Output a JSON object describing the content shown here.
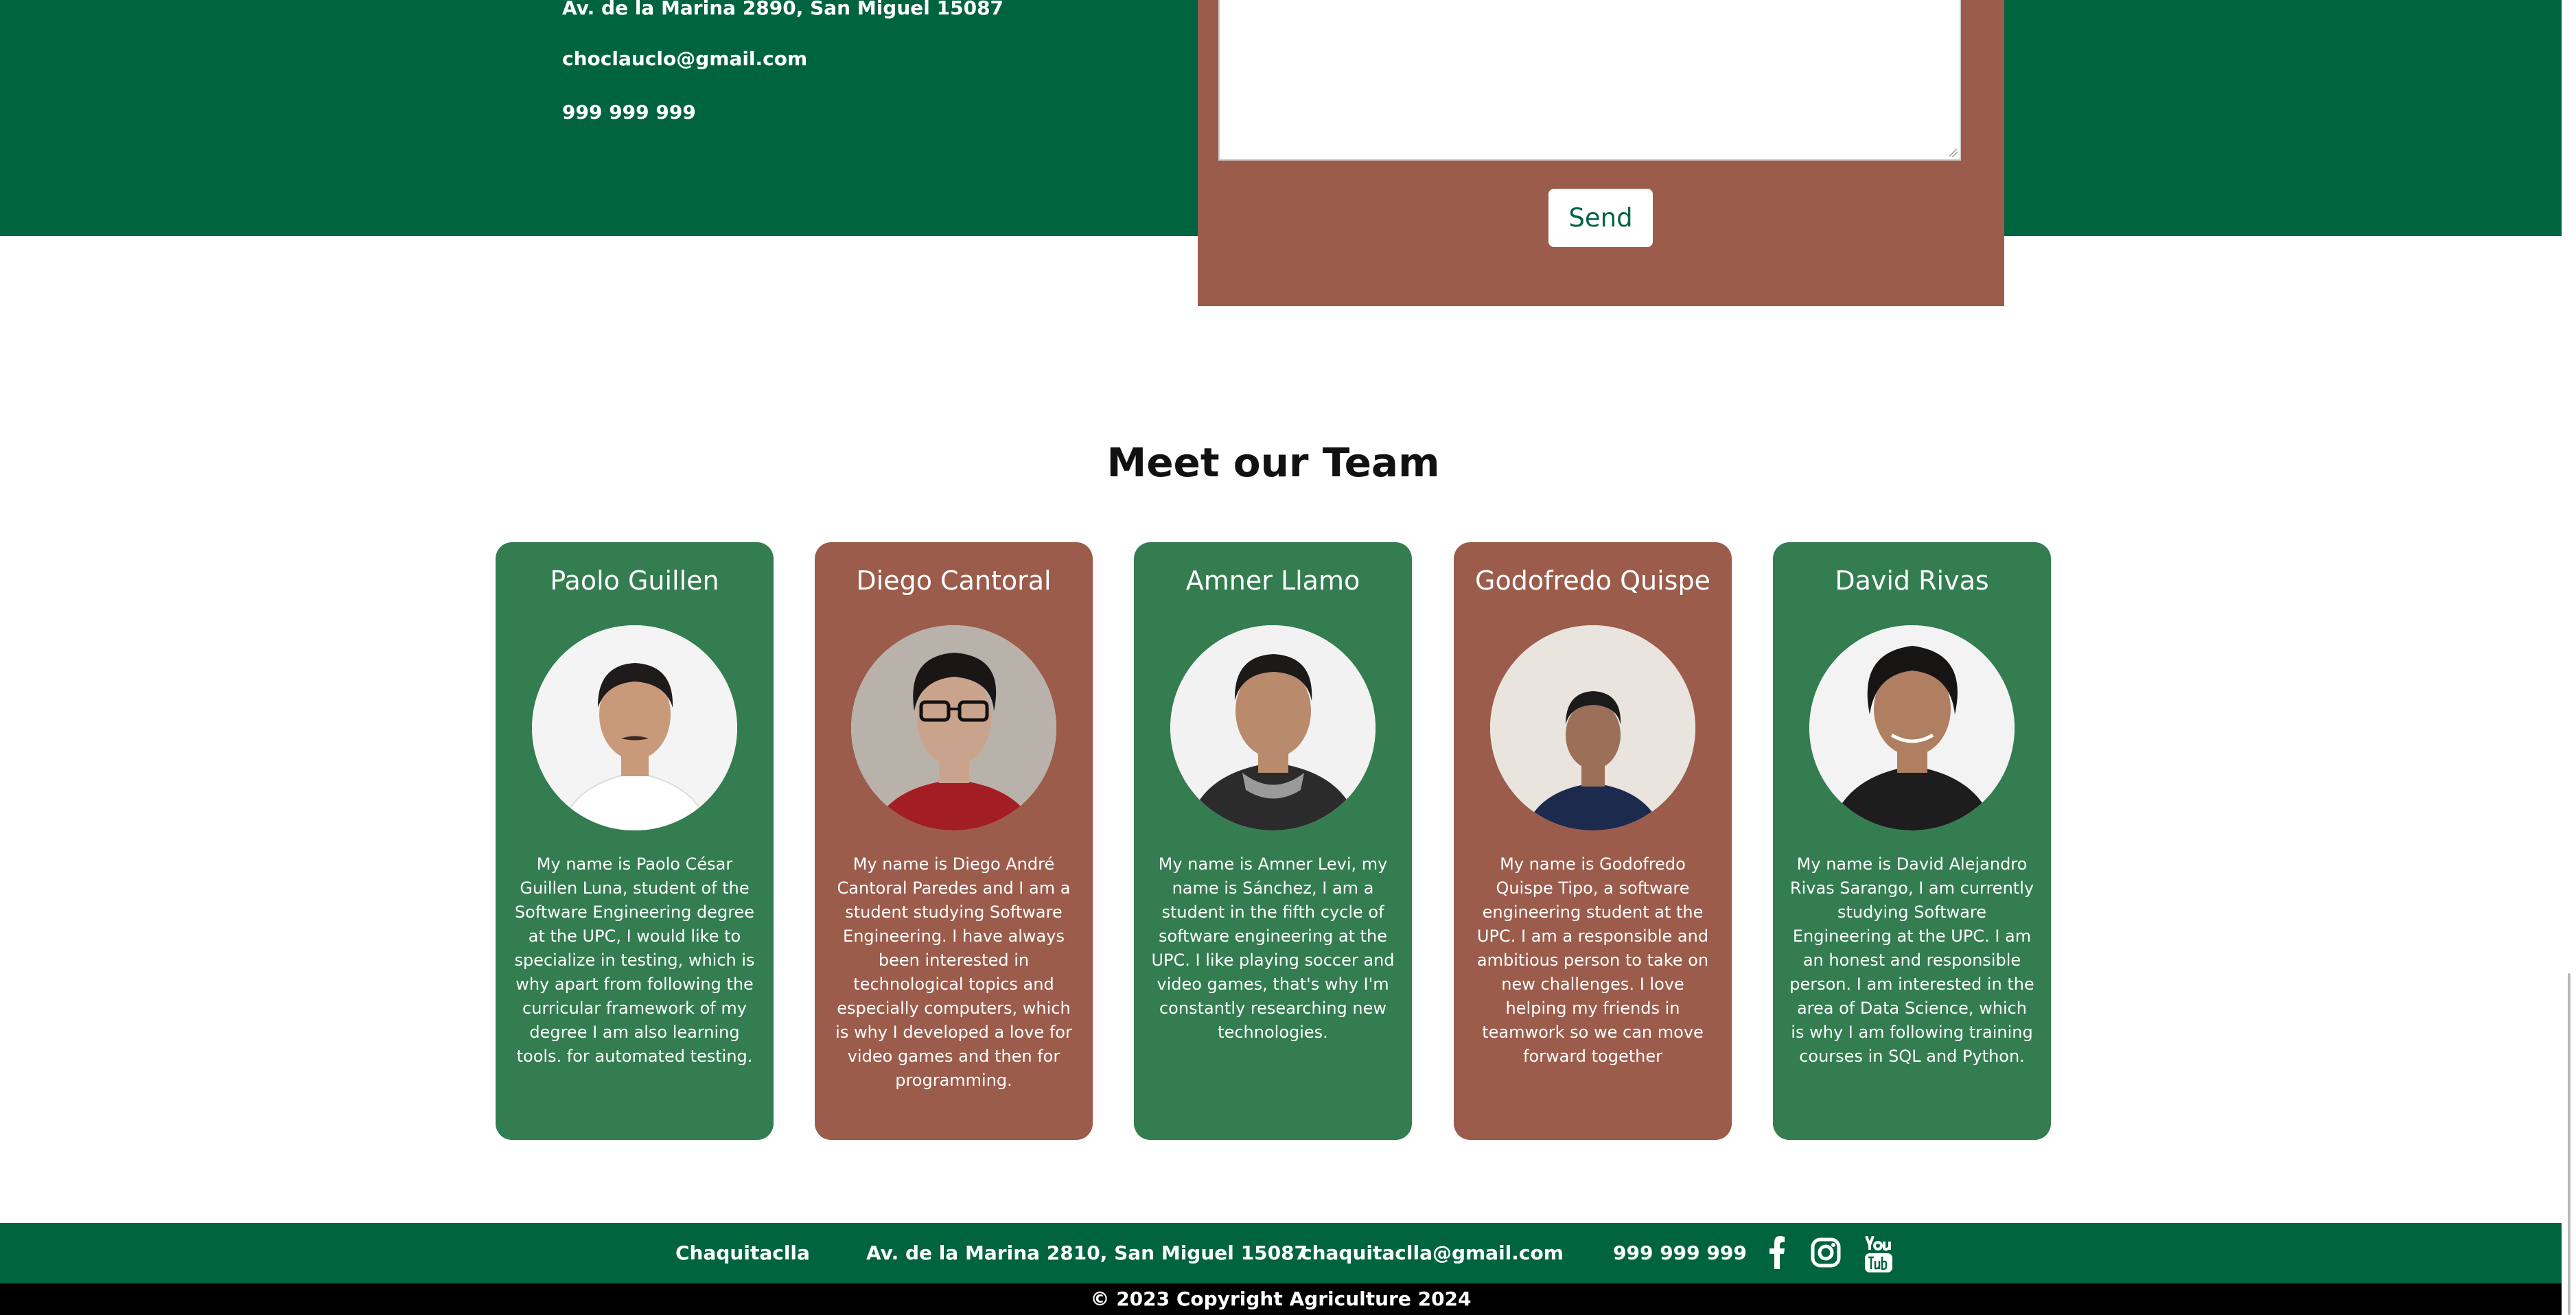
{
  "contact": {
    "address": "Av. de la Marina 2890, San Miguel 15087",
    "email": "choclauclo@gmail.com",
    "phone": "999 999 999"
  },
  "form": {
    "message_placeholder": "",
    "send_label": "Send"
  },
  "team": {
    "title": "Meet our Team",
    "members": [
      {
        "name": "Paolo Guillen",
        "bio": "My name is Paolo César Guillen Luna, student of the Software Engineering degree at the UPC, I would like to specialize in testing, which is why apart from following the curricular framework of my degree I am also learning tools. for automated testing."
      },
      {
        "name": "Diego Cantoral",
        "bio": "My name is Diego André Cantoral Paredes and I am a student studying Software Engineering. I have always been interested in technological topics and especially computers, which is why I developed a love for video games and then for programming."
      },
      {
        "name": "Amner Llamo",
        "bio": "My name is Amner Levi, my name is Sánchez, I am a student in the fifth cycle of software engineering at the UPC. I like playing soccer and video games, that's why I'm constantly researching new technologies."
      },
      {
        "name": "Godofredo Quispe",
        "bio": "My name is Godofredo Quispe Tipo, a software engineering student at the UPC. I am a responsible and ambitious person to take on new challenges. I love helping my friends in teamwork so we can move forward together"
      },
      {
        "name": "David Rivas",
        "bio": "My name is David Alejandro Rivas Sarango, I am currently studying Software Engineering at the UPC. I am an honest and responsible person. I am interested in the area of Data Science, which is why I am following training courses in SQL and Python."
      }
    ]
  },
  "footer": {
    "brand": "Chaquitaclla",
    "address": "Av. de la Marina 2810, San Miguel 15087",
    "email": "chaquitaclla@gmail.com",
    "phone": "999 999 999",
    "social_icons": [
      "facebook-icon",
      "instagram-icon",
      "youtube-icon"
    ],
    "copyright": "© 2023 Copyright Agriculture 2024"
  },
  "colors": {
    "primary_green": "#00643f",
    "card_green": "#337d50",
    "card_brown": "#9b5c4c",
    "footer_black": "#000000"
  }
}
